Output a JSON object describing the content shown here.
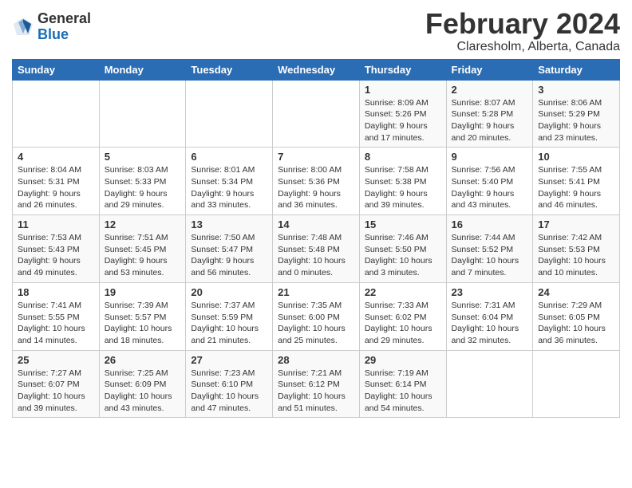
{
  "logo": {
    "general": "General",
    "blue": "Blue"
  },
  "title": "February 2024",
  "location": "Claresholm, Alberta, Canada",
  "days_of_week": [
    "Sunday",
    "Monday",
    "Tuesday",
    "Wednesday",
    "Thursday",
    "Friday",
    "Saturday"
  ],
  "weeks": [
    [
      {
        "day": "",
        "info": ""
      },
      {
        "day": "",
        "info": ""
      },
      {
        "day": "",
        "info": ""
      },
      {
        "day": "",
        "info": ""
      },
      {
        "day": "1",
        "info": "Sunrise: 8:09 AM\nSunset: 5:26 PM\nDaylight: 9 hours\nand 17 minutes."
      },
      {
        "day": "2",
        "info": "Sunrise: 8:07 AM\nSunset: 5:28 PM\nDaylight: 9 hours\nand 20 minutes."
      },
      {
        "day": "3",
        "info": "Sunrise: 8:06 AM\nSunset: 5:29 PM\nDaylight: 9 hours\nand 23 minutes."
      }
    ],
    [
      {
        "day": "4",
        "info": "Sunrise: 8:04 AM\nSunset: 5:31 PM\nDaylight: 9 hours\nand 26 minutes."
      },
      {
        "day": "5",
        "info": "Sunrise: 8:03 AM\nSunset: 5:33 PM\nDaylight: 9 hours\nand 29 minutes."
      },
      {
        "day": "6",
        "info": "Sunrise: 8:01 AM\nSunset: 5:34 PM\nDaylight: 9 hours\nand 33 minutes."
      },
      {
        "day": "7",
        "info": "Sunrise: 8:00 AM\nSunset: 5:36 PM\nDaylight: 9 hours\nand 36 minutes."
      },
      {
        "day": "8",
        "info": "Sunrise: 7:58 AM\nSunset: 5:38 PM\nDaylight: 9 hours\nand 39 minutes."
      },
      {
        "day": "9",
        "info": "Sunrise: 7:56 AM\nSunset: 5:40 PM\nDaylight: 9 hours\nand 43 minutes."
      },
      {
        "day": "10",
        "info": "Sunrise: 7:55 AM\nSunset: 5:41 PM\nDaylight: 9 hours\nand 46 minutes."
      }
    ],
    [
      {
        "day": "11",
        "info": "Sunrise: 7:53 AM\nSunset: 5:43 PM\nDaylight: 9 hours\nand 49 minutes."
      },
      {
        "day": "12",
        "info": "Sunrise: 7:51 AM\nSunset: 5:45 PM\nDaylight: 9 hours\nand 53 minutes."
      },
      {
        "day": "13",
        "info": "Sunrise: 7:50 AM\nSunset: 5:47 PM\nDaylight: 9 hours\nand 56 minutes."
      },
      {
        "day": "14",
        "info": "Sunrise: 7:48 AM\nSunset: 5:48 PM\nDaylight: 10 hours\nand 0 minutes."
      },
      {
        "day": "15",
        "info": "Sunrise: 7:46 AM\nSunset: 5:50 PM\nDaylight: 10 hours\nand 3 minutes."
      },
      {
        "day": "16",
        "info": "Sunrise: 7:44 AM\nSunset: 5:52 PM\nDaylight: 10 hours\nand 7 minutes."
      },
      {
        "day": "17",
        "info": "Sunrise: 7:42 AM\nSunset: 5:53 PM\nDaylight: 10 hours\nand 10 minutes."
      }
    ],
    [
      {
        "day": "18",
        "info": "Sunrise: 7:41 AM\nSunset: 5:55 PM\nDaylight: 10 hours\nand 14 minutes."
      },
      {
        "day": "19",
        "info": "Sunrise: 7:39 AM\nSunset: 5:57 PM\nDaylight: 10 hours\nand 18 minutes."
      },
      {
        "day": "20",
        "info": "Sunrise: 7:37 AM\nSunset: 5:59 PM\nDaylight: 10 hours\nand 21 minutes."
      },
      {
        "day": "21",
        "info": "Sunrise: 7:35 AM\nSunset: 6:00 PM\nDaylight: 10 hours\nand 25 minutes."
      },
      {
        "day": "22",
        "info": "Sunrise: 7:33 AM\nSunset: 6:02 PM\nDaylight: 10 hours\nand 29 minutes."
      },
      {
        "day": "23",
        "info": "Sunrise: 7:31 AM\nSunset: 6:04 PM\nDaylight: 10 hours\nand 32 minutes."
      },
      {
        "day": "24",
        "info": "Sunrise: 7:29 AM\nSunset: 6:05 PM\nDaylight: 10 hours\nand 36 minutes."
      }
    ],
    [
      {
        "day": "25",
        "info": "Sunrise: 7:27 AM\nSunset: 6:07 PM\nDaylight: 10 hours\nand 39 minutes."
      },
      {
        "day": "26",
        "info": "Sunrise: 7:25 AM\nSunset: 6:09 PM\nDaylight: 10 hours\nand 43 minutes."
      },
      {
        "day": "27",
        "info": "Sunrise: 7:23 AM\nSunset: 6:10 PM\nDaylight: 10 hours\nand 47 minutes."
      },
      {
        "day": "28",
        "info": "Sunrise: 7:21 AM\nSunset: 6:12 PM\nDaylight: 10 hours\nand 51 minutes."
      },
      {
        "day": "29",
        "info": "Sunrise: 7:19 AM\nSunset: 6:14 PM\nDaylight: 10 hours\nand 54 minutes."
      },
      {
        "day": "",
        "info": ""
      },
      {
        "day": "",
        "info": ""
      }
    ]
  ]
}
